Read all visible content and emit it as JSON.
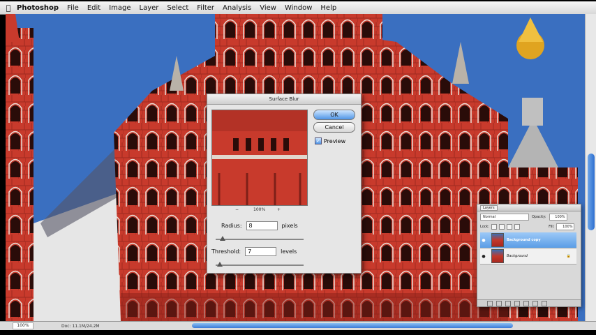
{
  "menubar": {
    "app_name": "Photoshop",
    "items": [
      "File",
      "Edit",
      "Image",
      "Layer",
      "Select",
      "Filter",
      "Analysis",
      "View",
      "Window",
      "Help"
    ]
  },
  "dialog": {
    "title": "Surface Blur",
    "ok_label": "OK",
    "cancel_label": "Cancel",
    "preview_label": "Preview",
    "preview_checked": true,
    "zoom_minus": "−",
    "zoom_plus": "+",
    "zoom_value": "100%",
    "radius": {
      "label": "Radius:",
      "value": "8",
      "unit": "pixels"
    },
    "threshold": {
      "label": "Threshold:",
      "value": "7",
      "unit": "levels"
    }
  },
  "layers_panel": {
    "tab": "Layers",
    "blend_mode": "Normal",
    "opacity_label": "Opacity:",
    "opacity_value": "100%",
    "lock_label": "Lock:",
    "fill_label": "Fill:",
    "fill_value": "100%",
    "layers": [
      {
        "name": "Background copy",
        "selected": true
      },
      {
        "name": "Background",
        "selected": false
      }
    ]
  },
  "statusbar": {
    "zoom": "100%",
    "doc_info": "Doc: 11.1M/24.2M"
  },
  "colors": {
    "sky": "#3a6fc0",
    "brick": "#c83a2c",
    "ok_button": "#4f95e6"
  }
}
